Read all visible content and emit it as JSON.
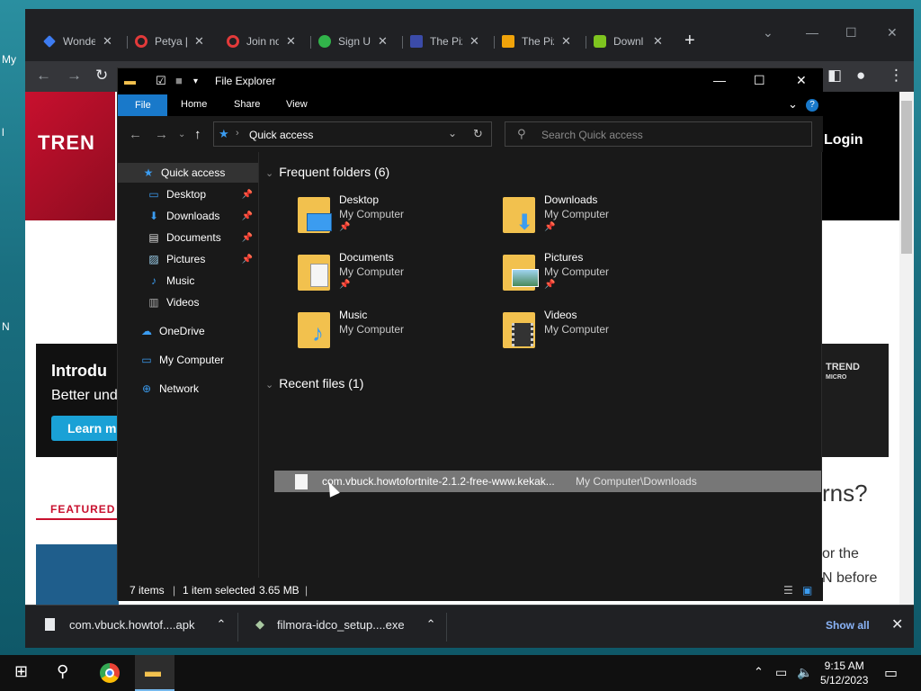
{
  "desktop": {
    "labels": [
      "My",
      "l",
      "N"
    ]
  },
  "browser": {
    "tabs": [
      {
        "label": "Wonde",
        "color": "#3d7cf2"
      },
      {
        "label": "Petya [",
        "color": "#e23a3a"
      },
      {
        "label": "Join no",
        "color": "#e23a3a"
      },
      {
        "label": "Sign U",
        "color": "#31b34a"
      },
      {
        "label": "The Piz",
        "color": "#3b4ba8"
      },
      {
        "label": "The Piz",
        "color": "#f0a30a"
      },
      {
        "label": "Downl",
        "color": "#7ec41f"
      }
    ],
    "page": {
      "logo": "TREN",
      "login": "Login",
      "banner_title": "Introdu",
      "banner_sub": "Better und",
      "banner_btn": "Learn m",
      "tm_micro_1": "TREND",
      "tm_micro_2": "MICRO",
      "featured": "FEATURED",
      "right_heading": "rns?",
      "right_line1": "or the",
      "right_line2": "N before"
    },
    "downloads": [
      {
        "name": "com.vbuck.howtof....apk"
      },
      {
        "name": "filmora-idco_setup....exe"
      }
    ],
    "show_all": "Show all"
  },
  "explorer": {
    "title": "File Explorer",
    "ribbon": {
      "file": "File",
      "home": "Home",
      "share": "Share",
      "view": "View"
    },
    "address": "Quick access",
    "search_placeholder": "Search Quick access",
    "nav": [
      {
        "label": "Quick access",
        "icon": "star-icon",
        "pinned": false
      },
      {
        "label": "Desktop",
        "icon": "desktop-icon",
        "pinned": true
      },
      {
        "label": "Downloads",
        "icon": "download-icon",
        "pinned": true
      },
      {
        "label": "Documents",
        "icon": "document-icon",
        "pinned": true
      },
      {
        "label": "Pictures",
        "icon": "picture-icon",
        "pinned": true
      },
      {
        "label": "Music",
        "icon": "music-icon",
        "pinned": false
      },
      {
        "label": "Videos",
        "icon": "video-icon",
        "pinned": false
      },
      {
        "label": "OneDrive",
        "icon": "cloud-icon",
        "pinned": false
      },
      {
        "label": "My Computer",
        "icon": "computer-icon",
        "pinned": false
      },
      {
        "label": "Network",
        "icon": "network-icon",
        "pinned": false
      }
    ],
    "frequent_header": "Frequent folders (6)",
    "folders": [
      {
        "name": "Desktop",
        "location": "My Computer"
      },
      {
        "name": "Downloads",
        "location": "My Computer"
      },
      {
        "name": "Documents",
        "location": "My Computer"
      },
      {
        "name": "Pictures",
        "location": "My Computer"
      },
      {
        "name": "Music",
        "location": "My Computer"
      },
      {
        "name": "Videos",
        "location": "My Computer"
      }
    ],
    "recent_header": "Recent files (1)",
    "recent_files": [
      {
        "name": "com.vbuck.howtofortnite-2.1.2-free-www.kekak...",
        "location": "My Computer\\Downloads"
      }
    ],
    "status": {
      "items": "7 items",
      "selected": "1 item selected",
      "size": "3.65 MB"
    }
  },
  "taskbar": {
    "time": "9:15 AM",
    "date": "5/12/2023"
  }
}
